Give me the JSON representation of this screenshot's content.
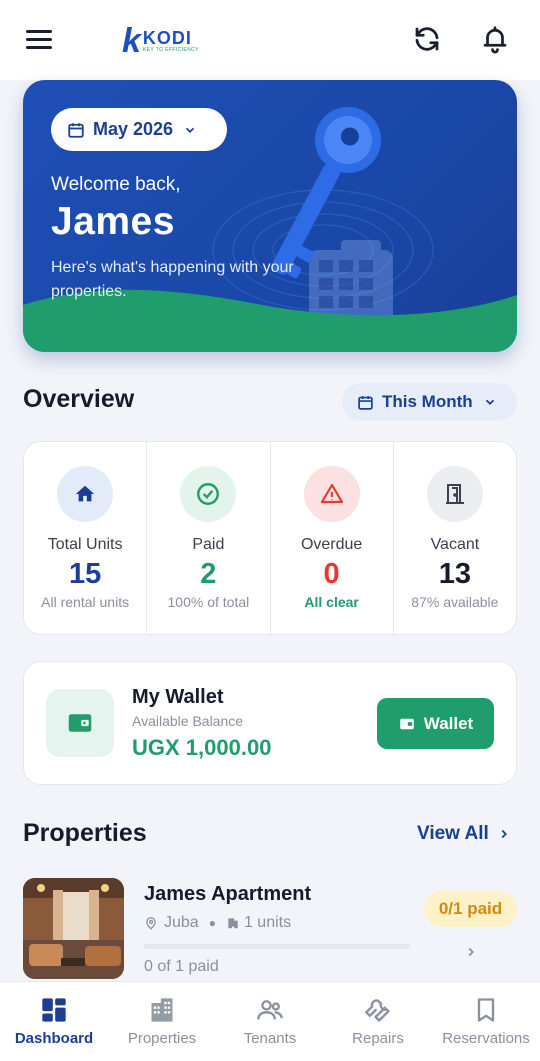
{
  "app": {
    "logo_letter": "k",
    "logo_name": "KODI",
    "logo_tagline": "KEY TO EFFICIENCY",
    "icons": {
      "menu": "hamburger-icon",
      "refresh": "refresh-icon",
      "notifications": "bell-icon"
    }
  },
  "hero": {
    "date_label": "May 2026",
    "welcome": "Welcome back,",
    "name": "James",
    "subtitle": "Here's what's happening with your properties."
  },
  "overview": {
    "title": "Overview",
    "period_label": "This Month",
    "stats": [
      {
        "label": "Total Units",
        "value": "15",
        "note": "All rental units",
        "icon": "home-icon",
        "color": "#1a3f94"
      },
      {
        "label": "Paid",
        "value": "2",
        "note": "100% of total",
        "icon": "check-circle-icon",
        "color": "#1f9d6c"
      },
      {
        "label": "Overdue",
        "value": "0",
        "note": "All clear",
        "icon": "warning-icon",
        "color": "#e53935"
      },
      {
        "label": "Vacant",
        "value": "13",
        "note": "87% available",
        "icon": "door-icon",
        "color": "#161b2b"
      }
    ]
  },
  "wallet": {
    "title": "My Wallet",
    "subtitle": "Available Balance",
    "amount": "UGX 1,000.00",
    "button_label": "Wallet"
  },
  "properties": {
    "title": "Properties",
    "view_all": "View All",
    "items": [
      {
        "name": "James Apartment",
        "location": "Juba",
        "units": "1 units",
        "paid_label": "0 of 1 paid",
        "badge": "0/1 paid",
        "paid_fraction": 0
      }
    ]
  },
  "nav": {
    "items": [
      {
        "label": "Dashboard",
        "icon": "dashboard-icon",
        "active": true
      },
      {
        "label": "Properties",
        "icon": "building-icon",
        "active": false
      },
      {
        "label": "Tenants",
        "icon": "users-icon",
        "active": false
      },
      {
        "label": "Repairs",
        "icon": "wrench-icon",
        "active": false
      },
      {
        "label": "Reservations",
        "icon": "bookmark-icon",
        "active": false
      }
    ]
  },
  "colors": {
    "primary": "#1a3f94",
    "accent_green": "#1f9d6c",
    "danger": "#e53935",
    "warning_badge_bg": "#fdf1c8",
    "warning_badge_text": "#d4890e"
  }
}
